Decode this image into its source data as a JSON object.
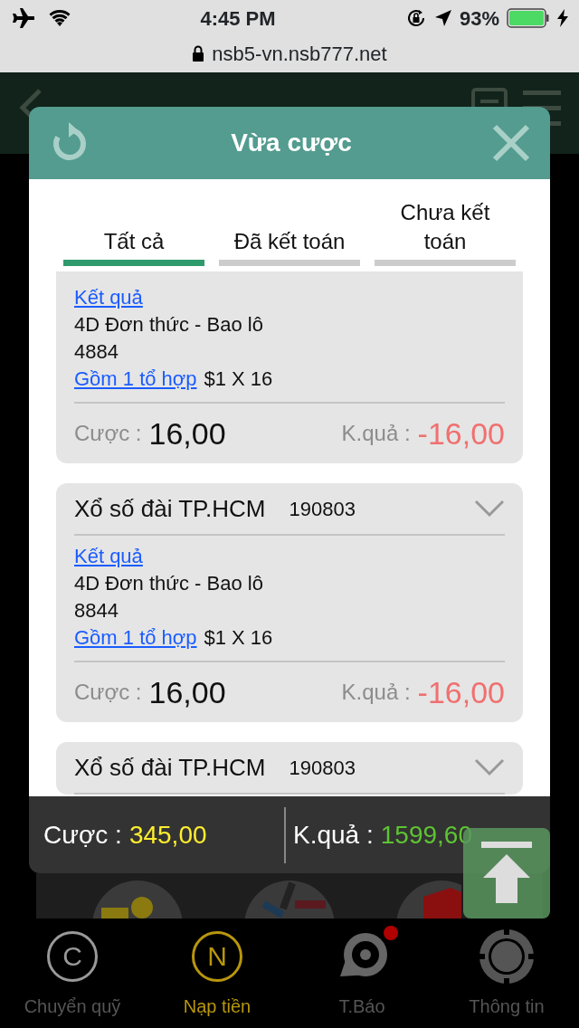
{
  "status_bar": {
    "time": "4:45 PM",
    "battery": "93%"
  },
  "address_bar": {
    "url": "nsb5-vn.nsb777.net"
  },
  "modal": {
    "title": "Vừa cược",
    "tabs": [
      {
        "label": "Tất cả",
        "selected": true
      },
      {
        "label": "Đã kết toán",
        "selected": false
      },
      {
        "label": "Chưa kết toán",
        "selected": false
      }
    ],
    "bets": [
      {
        "result_link": "Kết quả",
        "bet_type": "4D Đơn thức - Bao lô",
        "number": "4884",
        "combo_link": "Gồm 1 tổ hợp",
        "stake_detail": "$1 X 16",
        "stake_label": "Cược :",
        "stake": "16,00",
        "result_label": "K.quả :",
        "result": "-16,00"
      },
      {
        "title": "Xổ số đài TP.HCM",
        "code": "190803",
        "result_link": "Kết quả",
        "bet_type": "4D Đơn thức - Bao lô",
        "number": "8844",
        "combo_link": "Gồm 1 tổ hợp",
        "stake_detail": "$1 X 16",
        "stake_label": "Cược :",
        "stake": "16,00",
        "result_label": "K.quả :",
        "result": "-16,00"
      },
      {
        "title": "Xổ số đài TP.HCM",
        "code": "190803"
      }
    ],
    "summary": {
      "stake_label": "Cược :",
      "stake": "345,00",
      "result_label": "K.quả :",
      "result": "1599,60"
    }
  },
  "bottom_nav": [
    {
      "glyph": "C",
      "label": "Chuyển quỹ",
      "selected": false,
      "badge": false
    },
    {
      "glyph": "N",
      "label": "Nạp tiền",
      "selected": true,
      "badge": false
    },
    {
      "label": "T.Báo",
      "selected": false,
      "badge": true
    },
    {
      "label": "Thông tin",
      "selected": false,
      "badge": false
    }
  ]
}
